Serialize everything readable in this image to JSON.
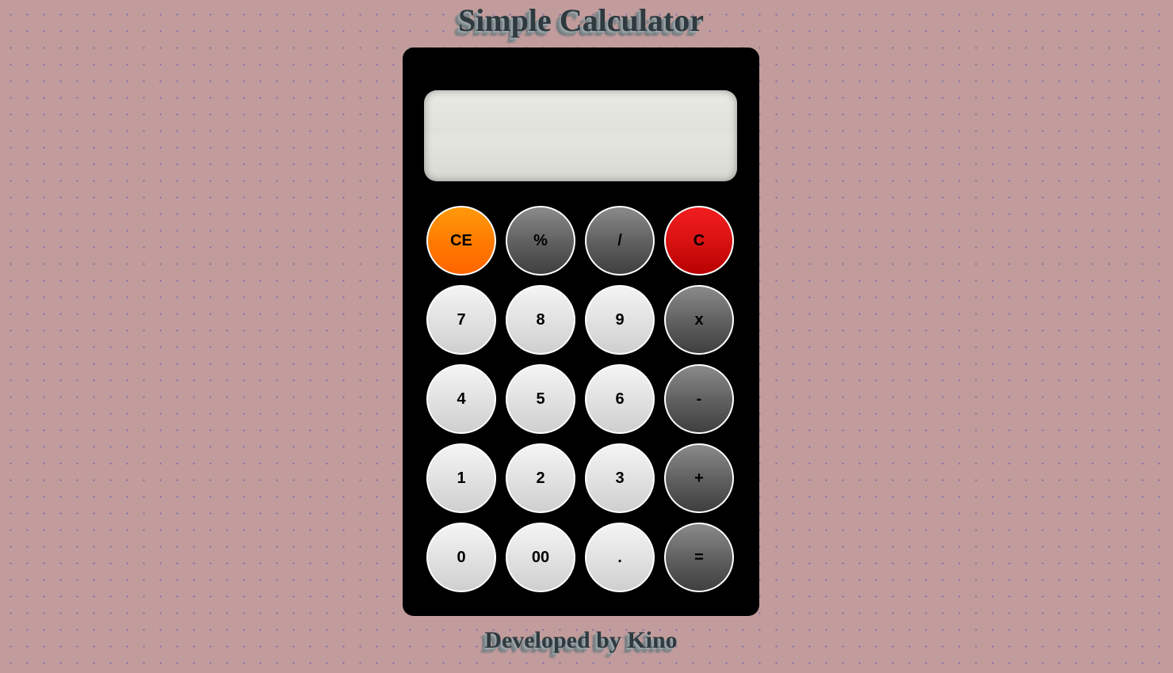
{
  "page": {
    "title": "Simple Calculator",
    "footer": "Developed by Kino"
  },
  "display": {
    "value": ""
  },
  "keys": {
    "row1": [
      {
        "label": "CE",
        "kind": "clear-entry"
      },
      {
        "label": "%",
        "kind": "operator"
      },
      {
        "label": "/",
        "kind": "operator"
      },
      {
        "label": "C",
        "kind": "clear"
      }
    ],
    "row2": [
      {
        "label": "7",
        "kind": "digit"
      },
      {
        "label": "8",
        "kind": "digit"
      },
      {
        "label": "9",
        "kind": "digit"
      },
      {
        "label": "x",
        "kind": "operator"
      }
    ],
    "row3": [
      {
        "label": "4",
        "kind": "digit"
      },
      {
        "label": "5",
        "kind": "digit"
      },
      {
        "label": "6",
        "kind": "digit"
      },
      {
        "label": "-",
        "kind": "operator"
      }
    ],
    "row4": [
      {
        "label": "1",
        "kind": "digit"
      },
      {
        "label": "2",
        "kind": "digit"
      },
      {
        "label": "3",
        "kind": "digit"
      },
      {
        "label": "+",
        "kind": "operator"
      }
    ],
    "row5": [
      {
        "label": "0",
        "kind": "digit"
      },
      {
        "label": "00",
        "kind": "digit"
      },
      {
        "label": ".",
        "kind": "digit"
      },
      {
        "label": "=",
        "kind": "operator"
      }
    ]
  },
  "colors": {
    "page_background": "#c29c9c",
    "dot_pattern": "#7a6ea8",
    "calculator_body": "#000000",
    "display_background": "#e0e2db",
    "digit_key": "#e2e2e2",
    "operator_key": "#5e5e5e",
    "clear_entry_key": "#ff7a00",
    "clear_key": "#d61010",
    "heading_text": "#2e3a3f"
  }
}
